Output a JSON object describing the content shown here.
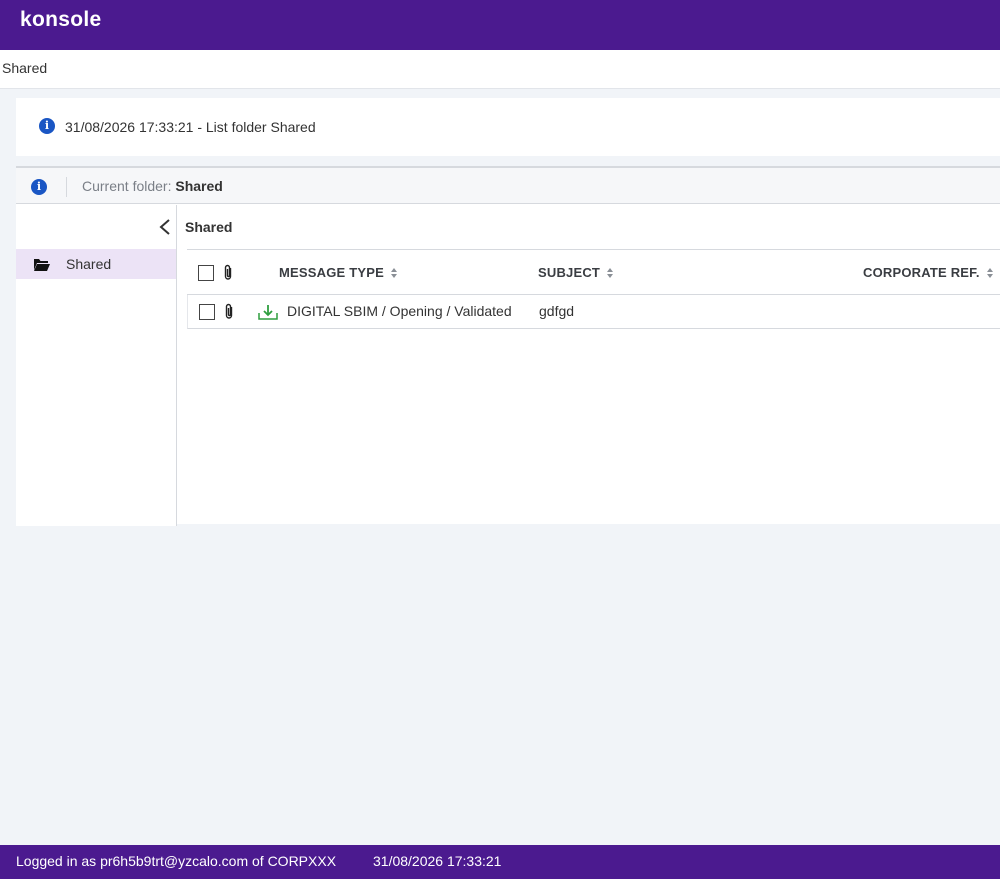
{
  "app": {
    "logo": "konsole"
  },
  "breadcrumb": "Shared",
  "notice": {
    "text": "31/08/2026 17:33:21 - List folder Shared"
  },
  "folder_bar": {
    "prefix": "Current folder:",
    "folder": "Shared"
  },
  "sidebar": {
    "items": [
      {
        "label": "Shared",
        "icon": "folder-open-icon"
      }
    ]
  },
  "content": {
    "title": "Shared",
    "columns": [
      {
        "label": "MESSAGE TYPE"
      },
      {
        "label": "SUBJECT"
      },
      {
        "label": "CORPORATE REF."
      }
    ],
    "rows": [
      {
        "message_type": "DIGITAL SBIM / Opening / Validated",
        "subject": "gdfgd",
        "corporate_ref": "",
        "icon": "download-icon"
      }
    ]
  },
  "footer": {
    "login": "Logged in as pr6h5b9trt@yzcalo.com of CORPXXX",
    "time": "31/08/2026 17:33:21"
  },
  "colors": {
    "brand": "#4b1a8f",
    "info": "#1a56c4",
    "selected": "#ece3f6",
    "success": "#2e9e3e"
  }
}
